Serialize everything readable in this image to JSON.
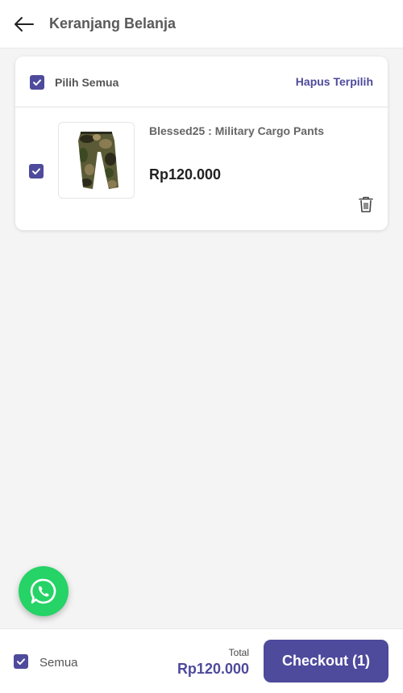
{
  "header": {
    "title": "Keranjang Belanja",
    "back_icon": "arrow-left-icon"
  },
  "cart": {
    "select_all_label": "Pilih Semua",
    "delete_selected_label": "Hapus Terpilih",
    "items": [
      {
        "name": "Blessed25 : Military Cargo Pants",
        "price": "Rp120.000",
        "checked": true,
        "image_icon": "cargo-pants-image"
      }
    ]
  },
  "footer": {
    "all_label": "Semua",
    "total_label": "Total",
    "total_value": "Rp120.000",
    "checkout_label": "Checkout (1)"
  },
  "fab": {
    "icon": "whatsapp-icon"
  },
  "colors": {
    "accent": "#4e4a9c",
    "whatsapp": "#25d366",
    "text_dark": "#222222",
    "text_muted": "#5a5a5a"
  }
}
